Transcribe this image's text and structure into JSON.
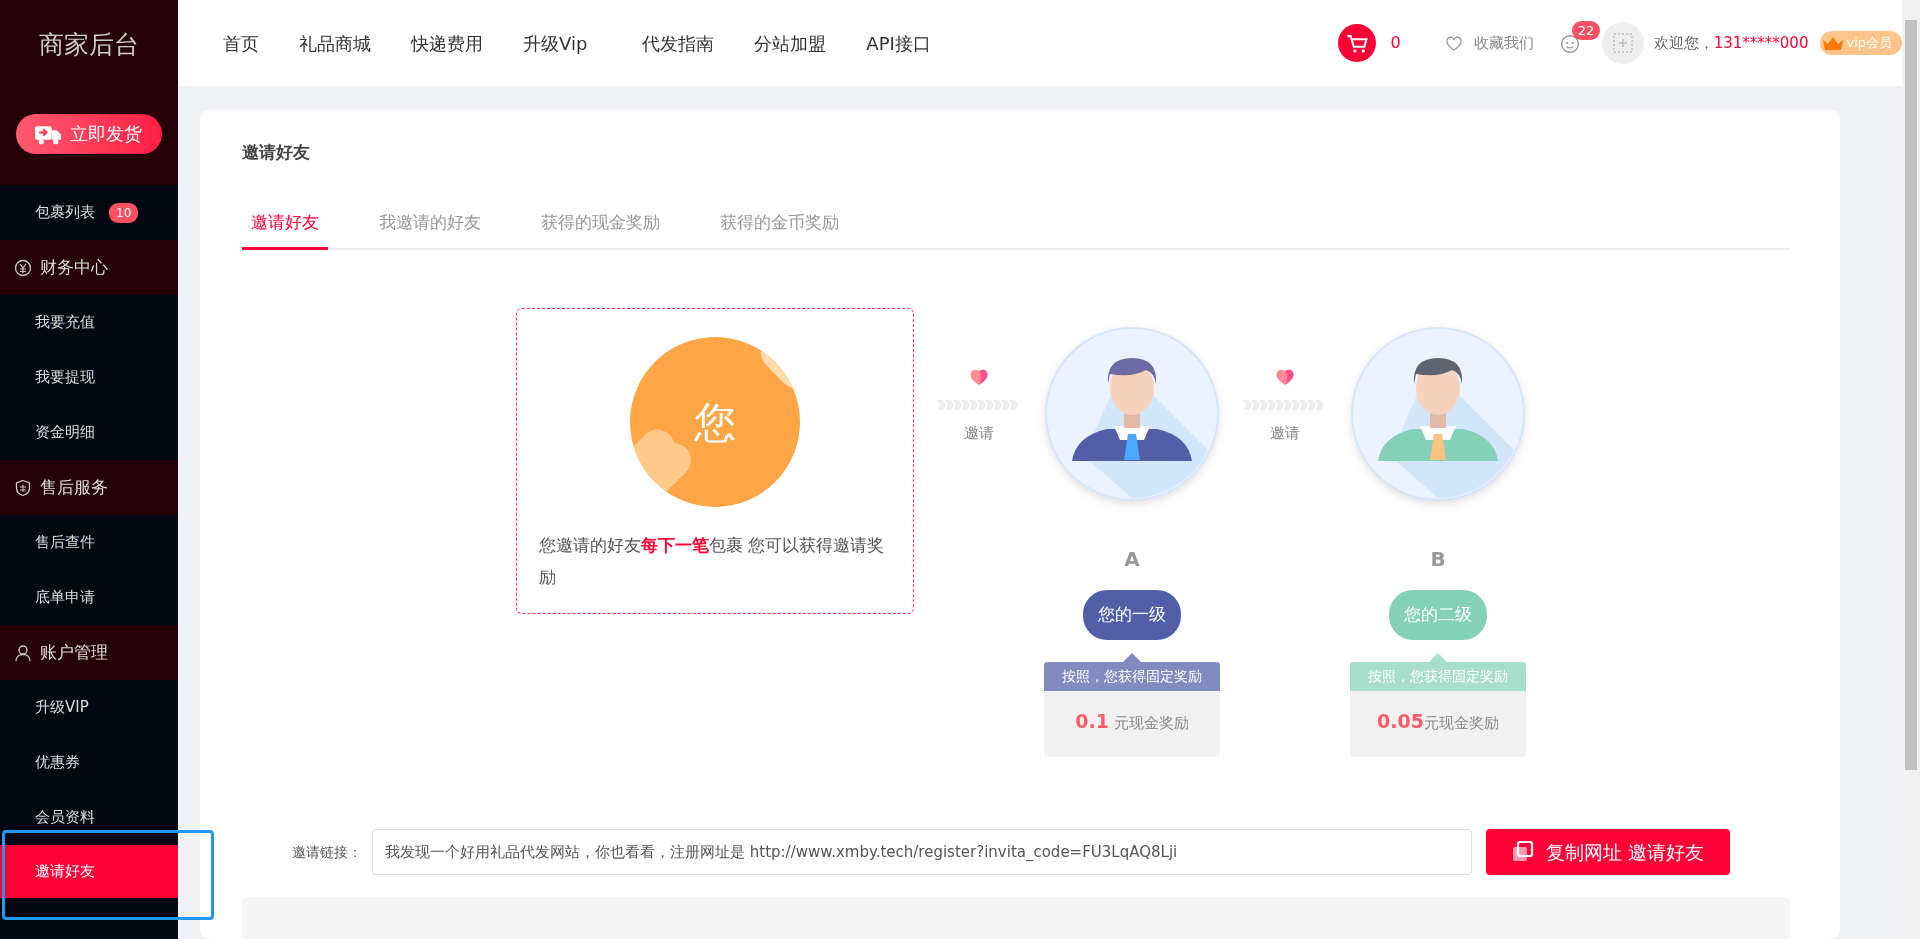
{
  "sidebar": {
    "title": "商家后台",
    "action_button": "立即发货",
    "items": [
      {
        "kind": "item",
        "label": "包裹列表",
        "badge": "10",
        "selected": false
      },
      {
        "kind": "group",
        "label": "财务中心"
      },
      {
        "kind": "item",
        "label": "我要充值",
        "selected": false
      },
      {
        "kind": "item",
        "label": "我要提现",
        "selected": false
      },
      {
        "kind": "item",
        "label": "资金明细",
        "selected": false
      },
      {
        "kind": "group",
        "label": "售后服务"
      },
      {
        "kind": "item",
        "label": "售后查件",
        "selected": false
      },
      {
        "kind": "item",
        "label": "底单申请",
        "selected": false
      },
      {
        "kind": "group",
        "label": "账户管理"
      },
      {
        "kind": "item",
        "label": "升级VIP",
        "selected": false
      },
      {
        "kind": "item",
        "label": "优惠券",
        "selected": false
      },
      {
        "kind": "item",
        "label": "会员资料",
        "selected": false
      },
      {
        "kind": "item",
        "label": "邀请好友",
        "selected": true
      }
    ]
  },
  "top_nav": {
    "links": [
      "首页",
      "礼品商城",
      "快递费用",
      "升级Vip",
      "代发指南",
      "分站加盟",
      "API接口"
    ],
    "cart_count": "0",
    "favorite": "收藏我们",
    "messages_badge": "22",
    "welcome": "欢迎您，",
    "account": "131*****000",
    "vip": "vip会员"
  },
  "page": {
    "title": "邀请好友",
    "tabs": [
      {
        "label": "邀请好友",
        "selected": true
      },
      {
        "label": "我邀请的好友",
        "selected": false
      },
      {
        "label": "获得的现金奖励",
        "selected": false
      },
      {
        "label": "获得的金币奖励",
        "selected": false
      }
    ],
    "you": {
      "avatar_text": "您",
      "description": "您邀请的好友**每下一笔**包裹 您可以获得邀请奖励"
    },
    "levels": [
      {
        "connector": "邀请",
        "letter": "A",
        "tier": "您的一级",
        "note": "按照，您获得固定奖励",
        "amount": "0.1",
        "unit": " 元现金奖励",
        "color": "#525ea6"
      },
      {
        "connector": "邀请",
        "letter": "B",
        "tier": "您的二级",
        "note": "按照，您获得固定奖励",
        "amount": "0.05",
        "unit": "元现金奖励",
        "color": "#85d1b8"
      }
    ],
    "invite": {
      "label": "邀请链接：",
      "value": "我发现一个好用礼品代发网站，你也看看，注册网址是 http://www.xmby.tech/register?invita_code=FU3LqAQ8Lji",
      "button": "复制网址 邀请好友"
    }
  }
}
